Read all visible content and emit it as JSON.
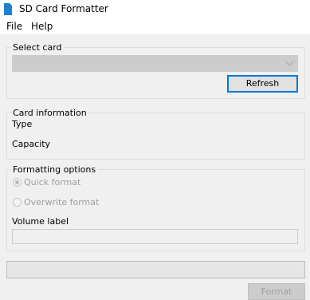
{
  "window": {
    "title": "SD Card Formatter",
    "icon": "sd-card-icon"
  },
  "menu": {
    "file": "File",
    "help": "Help"
  },
  "select_card": {
    "label": "Select card",
    "selected": "",
    "refresh_label": "Refresh"
  },
  "card_info": {
    "label": "Card information",
    "type_label": "Type",
    "capacity_label": "Capacity"
  },
  "formatting": {
    "label": "Formatting options",
    "quick_format": "Quick format",
    "overwrite_format": "Overwrite format",
    "volume_label": "Volume label",
    "volume_value": ""
  },
  "progress": {
    "percent": 0
  },
  "actions": {
    "format_label": "Format"
  },
  "colors": {
    "accent": "#0078d7",
    "icon": "#1e7fd0",
    "disabled_text": "#a0a0a0"
  }
}
